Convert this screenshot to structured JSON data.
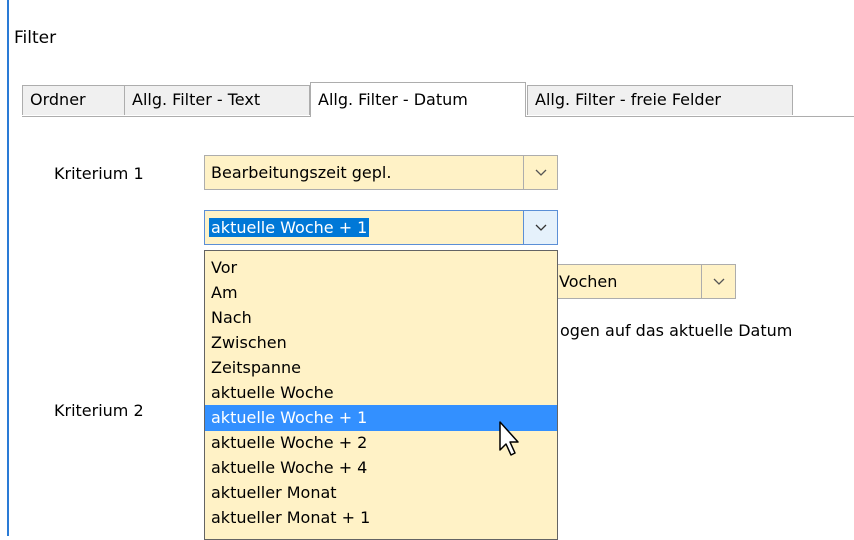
{
  "window": {
    "title": "Filter"
  },
  "tabs": [
    {
      "label": "Ordner"
    },
    {
      "label": "Allg. Filter - Text"
    },
    {
      "label": "Allg. Filter - Datum"
    },
    {
      "label": "Allg. Filter - freie Felder"
    }
  ],
  "active_tab": "Allg. Filter - Datum",
  "kriterium1": {
    "label": "Kriterium 1",
    "field_value": "Bearbeitungszeit gepl.",
    "operator_value": "aktuelle Woche + 1",
    "unit_value": "Wochen",
    "unit_value_visible": "Vochen",
    "note_visible": "ogen auf das aktuelle Datum"
  },
  "kriterium2": {
    "label": "Kriterium 2"
  },
  "dropdown": {
    "items": [
      "Vor",
      "Am",
      "Nach",
      "Zwischen",
      "Zeitspanne",
      "aktuelle Woche",
      "aktuelle Woche + 1",
      "aktuelle Woche + 2",
      "aktuelle Woche + 4",
      "aktueller Monat",
      "aktueller Monat + 1"
    ],
    "selected": "aktuelle Woche + 1"
  },
  "colors": {
    "combo_background": "#fff2c6",
    "selection": "#3390ff",
    "window_accent": "#2a7bd6"
  },
  "icons": {
    "combo_arrow": "chevron-down-icon",
    "cursor": "mouse-pointer-icon"
  }
}
